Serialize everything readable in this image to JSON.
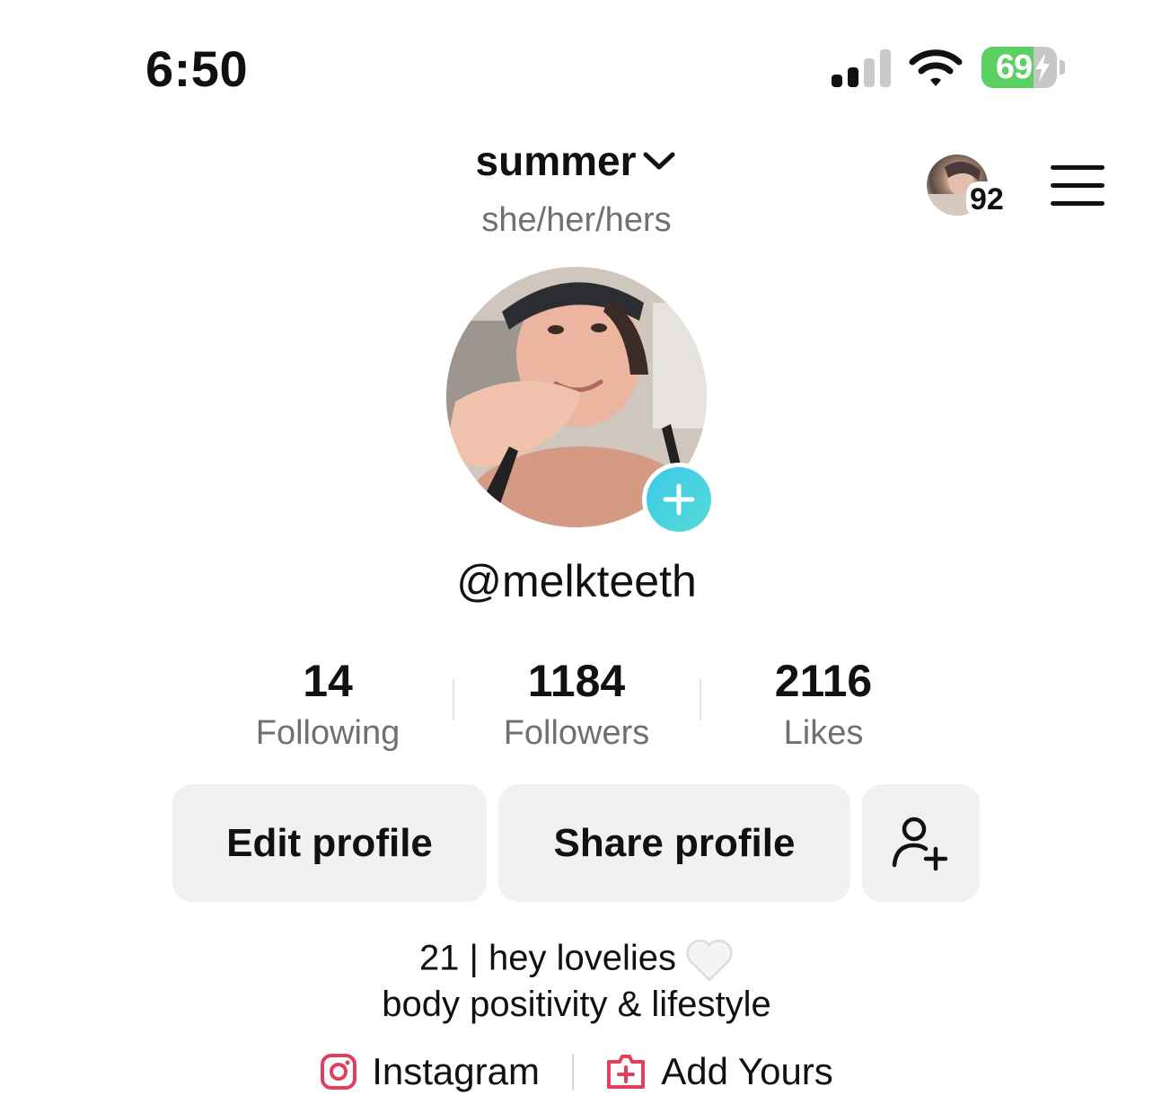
{
  "status_bar": {
    "time": "6:50",
    "battery_percent": "69",
    "battery_level": 0.69,
    "signal_bars_active": 2,
    "signal_bars_total": 4,
    "charging": true,
    "colors": {
      "battery_fill": "#5ad160",
      "battery_empty": "#c7c7c7"
    }
  },
  "header": {
    "username": "summer",
    "pronouns": "she/her/hers",
    "notification_count": "92",
    "icons": {
      "switch_account": "chevron-down-icon",
      "menu": "hamburger-menu-icon"
    }
  },
  "profile": {
    "handle": "@melkteeth",
    "add_avatar_icon": "plus-icon",
    "colors": {
      "add_button": "#3fc8ec"
    }
  },
  "stats": [
    {
      "value": "14",
      "label": "Following"
    },
    {
      "value": "1184",
      "label": "Followers"
    },
    {
      "value": "2116",
      "label": "Likes"
    }
  ],
  "actions": {
    "edit_label": "Edit profile",
    "share_label": "Share profile",
    "add_friends_icon": "add-person-icon"
  },
  "bio": {
    "line1": "21 | hey lovelies",
    "line1_emoji": "white-heart-icon",
    "line2": "body positivity & lifestyle"
  },
  "links": {
    "instagram_label": "Instagram",
    "add_yours_label": "Add Yours",
    "colors": {
      "link_icon": "#e0405e"
    }
  }
}
